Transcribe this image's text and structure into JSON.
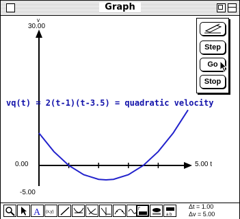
{
  "window": {
    "title": "Graph"
  },
  "graph": {
    "equation": "vq(t) = 2(t-1)(t-3.5) =  quadratic velocity",
    "y_axis_name": "v",
    "y_max_label": "30.00",
    "y_zero_label": "0.00",
    "y_min_label": "-5.00",
    "x_max_label": "5.00 t",
    "curve_color": "#2222cc"
  },
  "palette": {
    "step_label": "Step",
    "go_label": "Go",
    "stop_label": "Stop"
  },
  "toolbar": {
    "tools": [
      "magnifier-icon",
      "arrow-icon",
      "text-icon",
      "xy-coordinate-icon",
      "line-icon",
      "tangent-icon",
      "slope-icon",
      "integral-icon",
      "curve-fit-icon",
      "wave-icon",
      "derivative-icon",
      "graph-type-icon",
      "scale-icon"
    ],
    "dt_label": "Δt = 1.00",
    "dv_label": "Δv = 5.00"
  },
  "chart_data": {
    "type": "line",
    "x": [
      0,
      0.5,
      1,
      1.5,
      2,
      2.25,
      2.5,
      3,
      3.5,
      4,
      4.5,
      5
    ],
    "series": [
      {
        "values": [
          7,
          3,
          0,
          -2,
          -3,
          -3.125,
          -3,
          -2,
          0,
          3,
          7,
          12
        ]
      }
    ],
    "xlim": [
      0,
      5
    ],
    "ylim": [
      -5,
      30
    ],
    "ylabel": "v",
    "xlabel": "t"
  }
}
